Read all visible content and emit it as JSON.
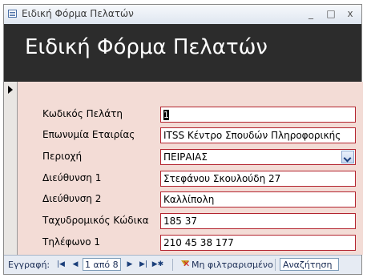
{
  "window": {
    "title": "Ειδική Φόρμα Πελατών",
    "minimize_icon": "_",
    "maximize_icon": "□",
    "close_icon": "x"
  },
  "header": {
    "title": "Ειδική Φόρμα Πελατών"
  },
  "fields": [
    {
      "label": "Κωδικός Πελάτη",
      "value": "1"
    },
    {
      "label": "Επωνυμία Εταιρίας",
      "value": "ITSS Κέντρο Σπουδών Πληροφορικής"
    },
    {
      "label": "Περιοχή",
      "value": "ΠΕΙΡΑΙΑΣ"
    },
    {
      "label": "Διεύθυνση 1",
      "value": "Στεφάνου Σκουλούδη 27"
    },
    {
      "label": "Διεύθυνση 2",
      "value": "Καλλίπολη"
    },
    {
      "label": "Ταχυδρομικός Κώδικα",
      "value": "185 37"
    },
    {
      "label": "Τηλέφωνο 1",
      "value": "210 45 38 177"
    }
  ],
  "navigation": {
    "label": "Εγγραφή:",
    "first_icon": "|◀",
    "prev_icon": "◀",
    "record_position": "1 από 8",
    "next_icon": "▶",
    "last_icon": "▶|",
    "new_icon": "▶✱",
    "filter_status": "Μη φιλτραρισμένο",
    "search_label": "Αναζήτηση"
  }
}
